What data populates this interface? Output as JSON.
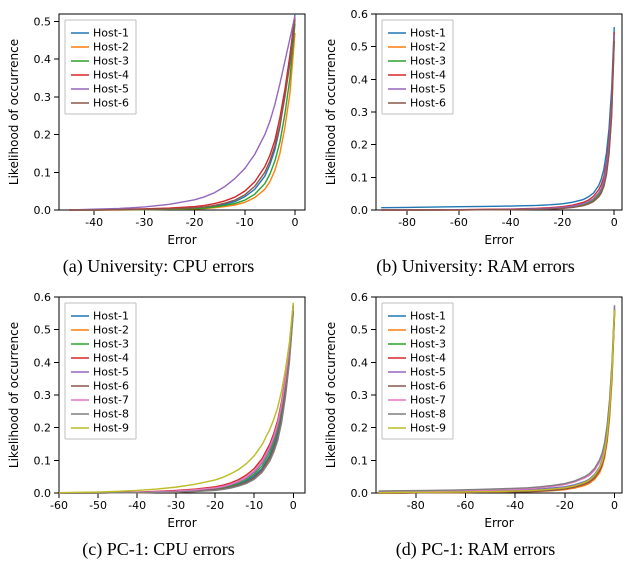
{
  "colors": {
    "tab10": [
      "#1f77b4",
      "#ff7f0e",
      "#2ca02c",
      "#d62728",
      "#9467bd",
      "#8c564b",
      "#e377c2",
      "#7f7f7f",
      "#bcbd22",
      "#17becf"
    ]
  },
  "legend_labels_6": [
    "Host-1",
    "Host-2",
    "Host-3",
    "Host-4",
    "Host-5",
    "Host-6"
  ],
  "legend_labels_9": [
    "Host-1",
    "Host-2",
    "Host-3",
    "Host-4",
    "Host-5",
    "Host-6",
    "Host-7",
    "Host-8",
    "Host-9"
  ],
  "axis": {
    "xlabel": "Error",
    "ylabel": "Likelihood of occurrence"
  },
  "captions": {
    "a": "(a) University: CPU errors",
    "b": "(b) University: RAM errors",
    "c": "(c) PC-1: CPU errors",
    "d": "(d) PC-1: RAM errors"
  },
  "chart_data": [
    {
      "id": "a",
      "type": "line",
      "title": "University: CPU errors",
      "xlabel": "Error",
      "ylabel": "Likelihood of occurrence",
      "xlim": [
        -47,
        2
      ],
      "ylim": [
        0,
        0.52
      ],
      "xticks": [
        -40,
        -30,
        -20,
        -10,
        0
      ],
      "yticks": [
        0.0,
        0.1,
        0.2,
        0.3,
        0.4,
        0.5
      ],
      "x": [
        -45,
        -40,
        -35,
        -30,
        -25,
        -20,
        -18,
        -16,
        -14,
        -12,
        -10,
        -8,
        -6,
        -5,
        -4,
        -3,
        -2,
        -1,
        0
      ],
      "legend": "legend_labels_6",
      "series": [
        {
          "name": "Host-1",
          "values": [
            0.0,
            0.0,
            0.001,
            0.002,
            0.003,
            0.005,
            0.007,
            0.01,
            0.015,
            0.022,
            0.035,
            0.055,
            0.09,
            0.12,
            0.16,
            0.22,
            0.31,
            0.41,
            0.52
          ]
        },
        {
          "name": "Host-2",
          "values": [
            0.0,
            0.0,
            0.0,
            0.001,
            0.002,
            0.003,
            0.004,
            0.006,
            0.009,
            0.013,
            0.02,
            0.033,
            0.055,
            0.075,
            0.105,
            0.15,
            0.22,
            0.31,
            0.47
          ]
        },
        {
          "name": "Host-3",
          "values": [
            0.0,
            0.0,
            0.001,
            0.001,
            0.002,
            0.004,
            0.005,
            0.008,
            0.012,
            0.017,
            0.026,
            0.042,
            0.07,
            0.095,
            0.13,
            0.18,
            0.255,
            0.35,
            0.495
          ]
        },
        {
          "name": "Host-4",
          "values": [
            0.0,
            0.001,
            0.002,
            0.003,
            0.005,
            0.009,
            0.012,
            0.017,
            0.024,
            0.034,
            0.05,
            0.075,
            0.115,
            0.145,
            0.185,
            0.245,
            0.32,
            0.41,
            0.51
          ]
        },
        {
          "name": "Host-5",
          "values": [
            0.0,
            0.002,
            0.004,
            0.008,
            0.015,
            0.027,
            0.035,
            0.046,
            0.062,
            0.083,
            0.11,
            0.148,
            0.2,
            0.235,
            0.28,
            0.335,
            0.395,
            0.455,
            0.515
          ]
        },
        {
          "name": "Host-6",
          "values": [
            0.0,
            0.0,
            0.001,
            0.002,
            0.003,
            0.006,
            0.008,
            0.012,
            0.018,
            0.026,
            0.04,
            0.063,
            0.1,
            0.13,
            0.17,
            0.225,
            0.3,
            0.39,
            0.505
          ]
        }
      ]
    },
    {
      "id": "b",
      "type": "line",
      "title": "University: RAM errors",
      "xlabel": "Error",
      "ylabel": "Likelihood of occurrence",
      "xlim": [
        -92,
        3
      ],
      "ylim": [
        0,
        0.6
      ],
      "xticks": [
        -80,
        -60,
        -40,
        -20,
        0
      ],
      "yticks": [
        0.0,
        0.1,
        0.2,
        0.3,
        0.4,
        0.5,
        0.6
      ],
      "x": [
        -90,
        -80,
        -70,
        -60,
        -50,
        -40,
        -30,
        -25,
        -20,
        -16,
        -12,
        -10,
        -8,
        -6,
        -5,
        -4,
        -3,
        -2,
        -1,
        0
      ],
      "legend": "legend_labels_6",
      "series": [
        {
          "name": "Host-1",
          "values": [
            0.007,
            0.008,
            0.009,
            0.01,
            0.011,
            0.012,
            0.014,
            0.016,
            0.019,
            0.024,
            0.032,
            0.04,
            0.052,
            0.075,
            0.095,
            0.125,
            0.175,
            0.25,
            0.37,
            0.56
          ]
        },
        {
          "name": "Host-2",
          "values": [
            0.0,
            0.0,
            0.0,
            0.0,
            0.001,
            0.002,
            0.003,
            0.004,
            0.006,
            0.009,
            0.014,
            0.019,
            0.027,
            0.042,
            0.055,
            0.075,
            0.11,
            0.175,
            0.29,
            0.52
          ]
        },
        {
          "name": "Host-3",
          "values": [
            0.0,
            0.0,
            0.0,
            0.001,
            0.001,
            0.002,
            0.003,
            0.005,
            0.007,
            0.011,
            0.017,
            0.022,
            0.031,
            0.047,
            0.06,
            0.082,
            0.12,
            0.185,
            0.305,
            0.53
          ]
        },
        {
          "name": "Host-4",
          "values": [
            0.0,
            0.0,
            0.001,
            0.001,
            0.002,
            0.003,
            0.005,
            0.007,
            0.01,
            0.015,
            0.023,
            0.03,
            0.042,
            0.062,
            0.078,
            0.102,
            0.145,
            0.215,
            0.335,
            0.545
          ]
        },
        {
          "name": "Host-5",
          "values": [
            0.0,
            0.0,
            0.0,
            0.001,
            0.001,
            0.002,
            0.004,
            0.005,
            0.008,
            0.012,
            0.019,
            0.025,
            0.035,
            0.052,
            0.066,
            0.09,
            0.13,
            0.2,
            0.32,
            0.535
          ]
        },
        {
          "name": "Host-6",
          "values": [
            0.0,
            0.0,
            0.0,
            0.0,
            0.001,
            0.001,
            0.002,
            0.003,
            0.005,
            0.008,
            0.013,
            0.018,
            0.026,
            0.04,
            0.052,
            0.072,
            0.108,
            0.172,
            0.288,
            0.518
          ]
        }
      ]
    },
    {
      "id": "c",
      "type": "line",
      "title": "PC-1: CPU errors",
      "xlabel": "Error",
      "ylabel": "Likelihood of occurrence",
      "xlim": [
        -60,
        3
      ],
      "ylim": [
        0,
        0.6
      ],
      "xticks": [
        -60,
        -50,
        -40,
        -30,
        -20,
        -10,
        0
      ],
      "yticks": [
        0.0,
        0.1,
        0.2,
        0.3,
        0.4,
        0.5,
        0.6
      ],
      "x": [
        -60,
        -55,
        -50,
        -45,
        -40,
        -35,
        -30,
        -25,
        -20,
        -18,
        -16,
        -14,
        -12,
        -10,
        -8,
        -6,
        -5,
        -4,
        -3,
        -2,
        -1,
        0
      ],
      "legend": "legend_labels_9",
      "series": [
        {
          "name": "Host-1",
          "values": [
            0.0,
            0.0,
            0.001,
            0.001,
            0.002,
            0.003,
            0.004,
            0.007,
            0.012,
            0.015,
            0.02,
            0.027,
            0.037,
            0.052,
            0.075,
            0.115,
            0.145,
            0.185,
            0.245,
            0.33,
            0.44,
            0.575
          ]
        },
        {
          "name": "Host-2",
          "values": [
            0.0,
            0.0,
            0.0,
            0.001,
            0.001,
            0.002,
            0.003,
            0.005,
            0.009,
            0.012,
            0.016,
            0.022,
            0.031,
            0.044,
            0.065,
            0.1,
            0.128,
            0.165,
            0.22,
            0.3,
            0.405,
            0.555
          ]
        },
        {
          "name": "Host-3",
          "values": [
            0.0,
            0.0,
            0.001,
            0.001,
            0.002,
            0.003,
            0.005,
            0.008,
            0.013,
            0.017,
            0.022,
            0.03,
            0.041,
            0.058,
            0.083,
            0.125,
            0.155,
            0.195,
            0.255,
            0.335,
            0.44,
            0.575
          ]
        },
        {
          "name": "Host-4",
          "values": [
            0.0,
            0.001,
            0.001,
            0.002,
            0.003,
            0.005,
            0.008,
            0.012,
            0.019,
            0.024,
            0.031,
            0.041,
            0.055,
            0.075,
            0.105,
            0.15,
            0.182,
            0.222,
            0.28,
            0.355,
            0.45,
            0.58
          ]
        },
        {
          "name": "Host-5",
          "values": [
            0.0,
            0.0,
            0.001,
            0.001,
            0.002,
            0.003,
            0.005,
            0.009,
            0.015,
            0.019,
            0.025,
            0.034,
            0.046,
            0.064,
            0.092,
            0.135,
            0.165,
            0.205,
            0.265,
            0.345,
            0.445,
            0.578
          ]
        },
        {
          "name": "Host-6",
          "values": [
            0.0,
            0.0,
            0.0,
            0.001,
            0.001,
            0.002,
            0.003,
            0.006,
            0.01,
            0.013,
            0.017,
            0.024,
            0.033,
            0.047,
            0.07,
            0.108,
            0.136,
            0.172,
            0.228,
            0.308,
            0.415,
            0.56
          ]
        },
        {
          "name": "Host-7",
          "values": [
            0.0,
            0.0,
            0.001,
            0.001,
            0.002,
            0.004,
            0.006,
            0.01,
            0.016,
            0.02,
            0.027,
            0.036,
            0.049,
            0.068,
            0.097,
            0.142,
            0.173,
            0.213,
            0.272,
            0.35,
            0.448,
            0.578
          ]
        },
        {
          "name": "Host-8",
          "values": [
            0.0,
            0.0,
            0.0,
            0.001,
            0.001,
            0.002,
            0.003,
            0.005,
            0.008,
            0.011,
            0.015,
            0.021,
            0.029,
            0.042,
            0.063,
            0.098,
            0.125,
            0.16,
            0.215,
            0.295,
            0.4,
            0.552
          ]
        },
        {
          "name": "Host-9",
          "values": [
            0.001,
            0.002,
            0.003,
            0.005,
            0.008,
            0.012,
            0.018,
            0.027,
            0.04,
            0.048,
            0.059,
            0.072,
            0.09,
            0.114,
            0.148,
            0.195,
            0.225,
            0.262,
            0.312,
            0.378,
            0.46,
            0.582
          ]
        }
      ]
    },
    {
      "id": "d",
      "type": "line",
      "title": "PC-1: RAM errors",
      "xlabel": "Error",
      "ylabel": "Likelihood of occurrence",
      "xlim": [
        -96,
        3
      ],
      "ylim": [
        0,
        0.6
      ],
      "xticks": [
        -80,
        -60,
        -40,
        -20,
        0
      ],
      "yticks": [
        0.0,
        0.1,
        0.2,
        0.3,
        0.4,
        0.5,
        0.6
      ],
      "x": [
        -95,
        -85,
        -75,
        -65,
        -55,
        -45,
        -35,
        -30,
        -25,
        -20,
        -16,
        -12,
        -10,
        -8,
        -6,
        -5,
        -4,
        -3,
        -2,
        -1,
        0
      ],
      "legend": "legend_labels_9",
      "series": [
        {
          "name": "Host-1",
          "values": [
            0.003,
            0.004,
            0.005,
            0.006,
            0.007,
            0.008,
            0.01,
            0.012,
            0.015,
            0.019,
            0.025,
            0.035,
            0.043,
            0.057,
            0.08,
            0.1,
            0.13,
            0.18,
            0.26,
            0.38,
            0.565
          ]
        },
        {
          "name": "Host-2",
          "values": [
            0.0,
            0.0,
            0.001,
            0.001,
            0.002,
            0.003,
            0.004,
            0.005,
            0.007,
            0.01,
            0.015,
            0.023,
            0.03,
            0.042,
            0.062,
            0.08,
            0.108,
            0.155,
            0.23,
            0.35,
            0.545
          ]
        },
        {
          "name": "Host-3",
          "values": [
            0.001,
            0.001,
            0.002,
            0.003,
            0.004,
            0.005,
            0.007,
            0.009,
            0.012,
            0.016,
            0.022,
            0.032,
            0.04,
            0.054,
            0.077,
            0.096,
            0.125,
            0.175,
            0.255,
            0.375,
            0.56
          ]
        },
        {
          "name": "Host-4",
          "values": [
            0.0,
            0.001,
            0.001,
            0.002,
            0.003,
            0.004,
            0.006,
            0.008,
            0.011,
            0.015,
            0.021,
            0.031,
            0.039,
            0.053,
            0.075,
            0.094,
            0.123,
            0.172,
            0.252,
            0.372,
            0.558
          ]
        },
        {
          "name": "Host-5",
          "values": [
            0.002,
            0.003,
            0.004,
            0.005,
            0.006,
            0.007,
            0.009,
            0.011,
            0.014,
            0.018,
            0.024,
            0.034,
            0.042,
            0.056,
            0.079,
            0.098,
            0.128,
            0.178,
            0.258,
            0.378,
            0.562
          ]
        },
        {
          "name": "Host-6",
          "values": [
            0.0,
            0.0,
            0.001,
            0.001,
            0.002,
            0.003,
            0.004,
            0.006,
            0.008,
            0.012,
            0.018,
            0.027,
            0.034,
            0.047,
            0.068,
            0.087,
            0.116,
            0.164,
            0.242,
            0.362,
            0.55
          ]
        },
        {
          "name": "Host-7",
          "values": [
            0.004,
            0.005,
            0.006,
            0.007,
            0.008,
            0.01,
            0.013,
            0.016,
            0.02,
            0.026,
            0.034,
            0.046,
            0.055,
            0.07,
            0.095,
            0.115,
            0.146,
            0.198,
            0.278,
            0.395,
            0.572
          ]
        },
        {
          "name": "Host-8",
          "values": [
            0.006,
            0.007,
            0.008,
            0.009,
            0.011,
            0.013,
            0.016,
            0.019,
            0.023,
            0.029,
            0.037,
            0.05,
            0.06,
            0.076,
            0.102,
            0.122,
            0.154,
            0.206,
            0.286,
            0.402,
            0.575
          ]
        },
        {
          "name": "Host-9",
          "values": [
            0.001,
            0.002,
            0.002,
            0.003,
            0.004,
            0.005,
            0.007,
            0.009,
            0.012,
            0.016,
            0.022,
            0.032,
            0.04,
            0.054,
            0.077,
            0.096,
            0.126,
            0.176,
            0.256,
            0.376,
            0.56
          ]
        }
      ]
    }
  ]
}
